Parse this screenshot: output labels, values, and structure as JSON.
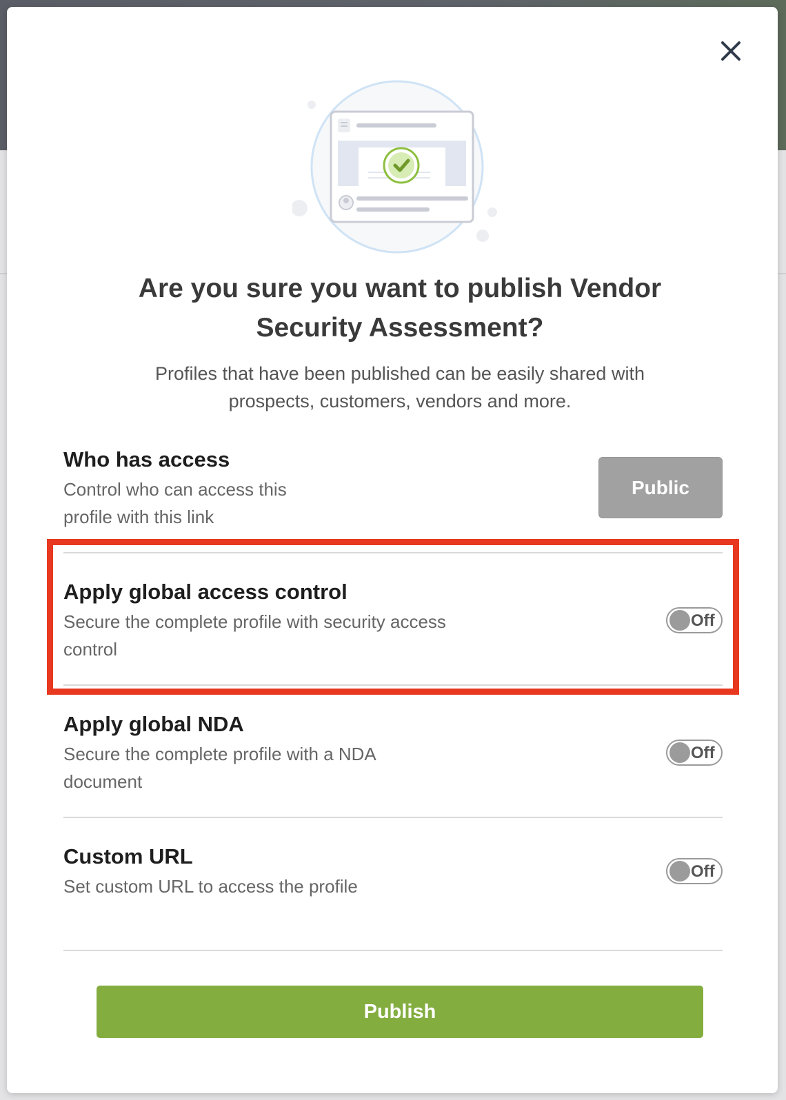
{
  "modal": {
    "title": "Are you sure you want to publish Vendor Security Assessment?",
    "subtitle": "Profiles that have been published can be easily shared with prospects, customers, vendors and more.",
    "close_icon": "close-icon",
    "illustration_icon": "published-profile-illustration"
  },
  "access": {
    "title": "Who has access",
    "description": "Control who can access this profile with this link",
    "button_label": "Public"
  },
  "settings": [
    {
      "title": "Apply global access control",
      "description": "Secure the complete profile with security access control",
      "toggle_label": "Off",
      "enabled": false
    },
    {
      "title": "Apply global NDA",
      "description": "Secure the complete profile with a NDA document",
      "toggle_label": "Off",
      "enabled": false
    },
    {
      "title": "Custom URL",
      "description": "Set custom URL to access the profile",
      "toggle_label": "Off",
      "enabled": false
    }
  ],
  "footer": {
    "publish_label": "Publish"
  },
  "colors": {
    "accent_green": "#84ad40",
    "highlight_red": "#e8381f",
    "public_button_gray": "#a1a1a1"
  }
}
